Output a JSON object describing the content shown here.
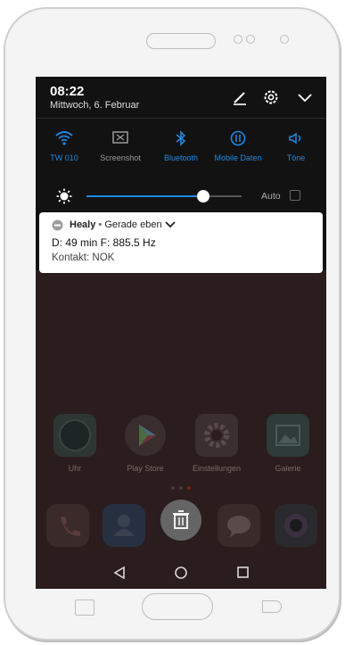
{
  "status": {
    "time": "08:22",
    "date": "Mittwoch, 6. Februar"
  },
  "header_icons": [
    "edit-icon",
    "settings-gear-icon",
    "collapse-chevron-icon"
  ],
  "quick_settings": [
    {
      "label": "TW 010",
      "icon": "wifi-icon",
      "active": true
    },
    {
      "label": "Screenshot",
      "icon": "screenshot-icon",
      "active": false
    },
    {
      "label": "Bluetooth",
      "icon": "bluetooth-icon",
      "active": true
    },
    {
      "label": "Mobile Daten",
      "icon": "mobile-data-icon",
      "active": true
    },
    {
      "label": "Töne",
      "icon": "sound-icon",
      "active": true
    }
  ],
  "brightness": {
    "level": 0.75,
    "auto_label": "Auto",
    "auto_checked": false
  },
  "notification": {
    "app": "Healy",
    "time": "Gerade eben",
    "line1": "D: 49 min F: 885.5 Hz",
    "line2": "Kontakt: NOK"
  },
  "home_apps": [
    {
      "label": "Uhr",
      "icon": "clock-icon"
    },
    {
      "label": "Play Store",
      "icon": "play-store-icon"
    },
    {
      "label": "Einstellungen",
      "icon": "settings-icon"
    },
    {
      "label": "Galerie",
      "icon": "gallery-icon"
    }
  ],
  "dock": [
    "phone-icon",
    "contacts-icon",
    "trash-icon",
    "messages-icon",
    "camera-icon"
  ],
  "colors": {
    "accent": "#1e88e5",
    "shade": "#121212",
    "dimmed_background": "#2b1d1d"
  }
}
